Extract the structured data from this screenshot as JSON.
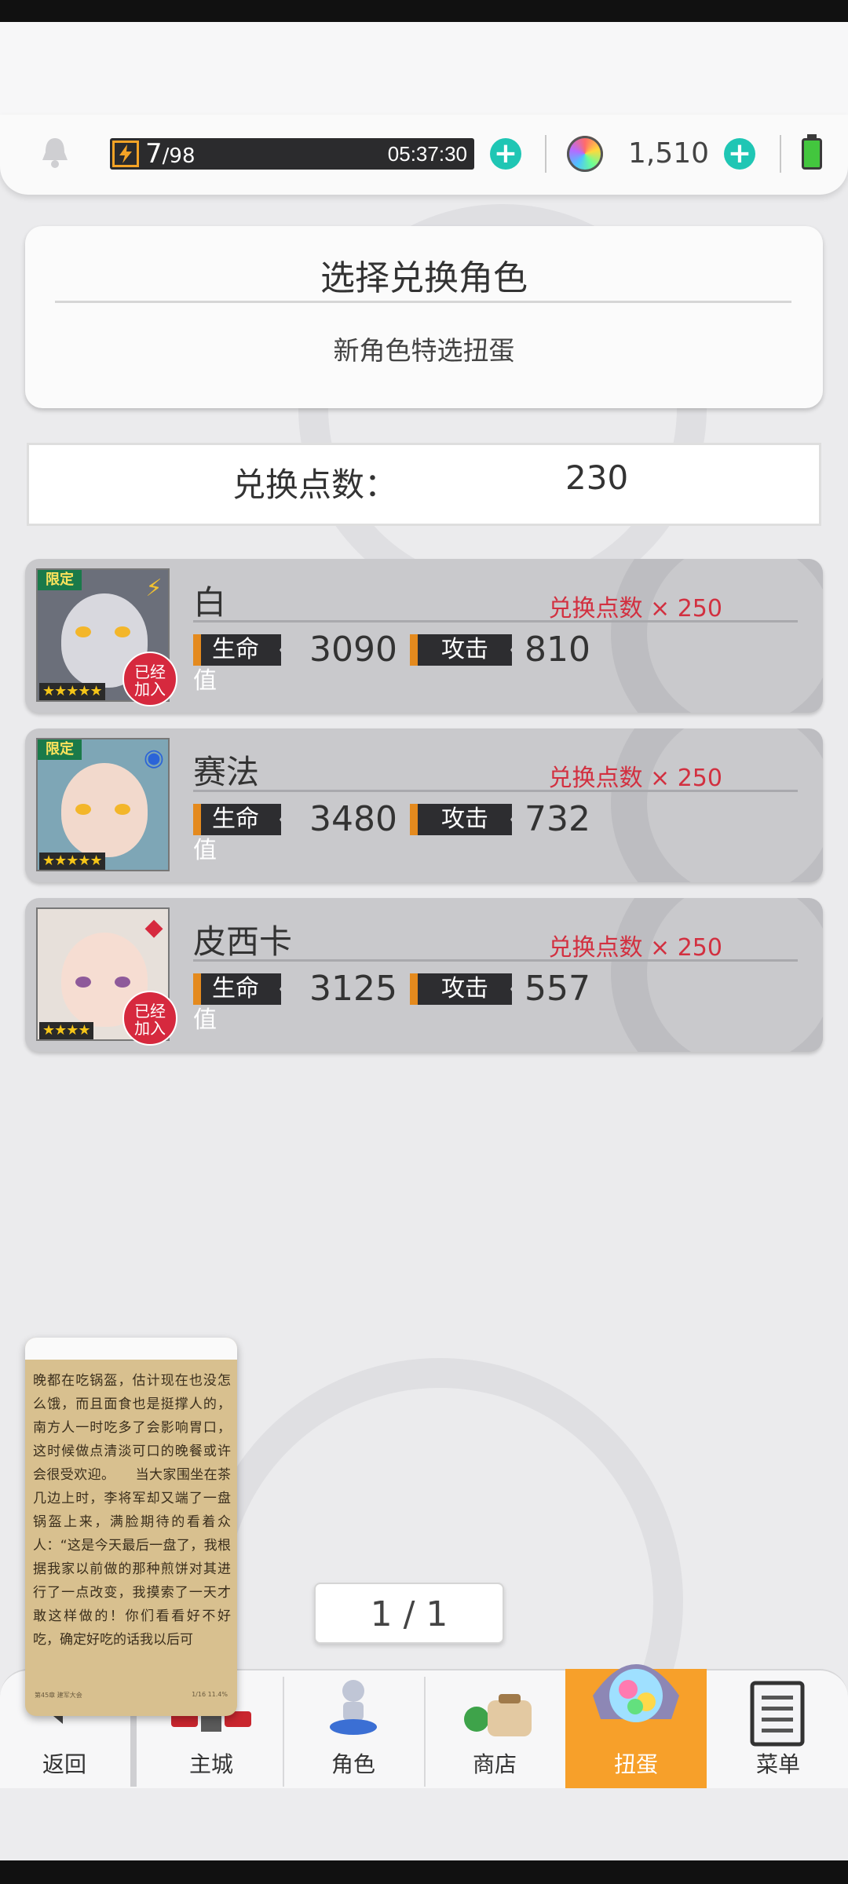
{
  "resource_bar": {
    "stamina_current": "7",
    "stamina_max": "/98",
    "stamina_timer": "05:37:30",
    "gems": "1,510",
    "icons": [
      "bell-icon",
      "lightning-icon",
      "plus-icon",
      "gem-icon",
      "battery-icon"
    ]
  },
  "header": {
    "title": "选择兑换角色",
    "subtitle": "新角色特选扭蛋"
  },
  "points": {
    "label": "兑换点数：",
    "value": "230"
  },
  "characters": [
    {
      "name": "白",
      "cost": "兑换点数 × 250",
      "hp_label": "生命值",
      "hp": "3090",
      "atk_label": "攻击",
      "atk": "810",
      "limited": "限定",
      "stars": "★★★★★",
      "joined": "已经加入",
      "element": "⚡"
    },
    {
      "name": "赛法",
      "cost": "兑换点数 × 250",
      "hp_label": "生命值",
      "hp": "3480",
      "atk_label": "攻击",
      "atk": "732",
      "limited": "限定",
      "stars": "★★★★★",
      "element": "◉"
    },
    {
      "name": "皮西卡",
      "cost": "兑换点数 × 250",
      "hp_label": "生命值",
      "hp": "3125",
      "atk_label": "攻击",
      "atk": "557",
      "stars": "★★★★",
      "joined": "已经加入",
      "element": "◆"
    }
  ],
  "joined_line1": "已经",
  "joined_line2": "加入",
  "reader": {
    "text": "晚都在吃锅盔，估计现在也没怎么饿，而且面食也是挺撑人的，南方人一时吃多了会影响胃口，这时候做点清淡可口的晚餐或许会很受欢迎。　　当大家围坐在茶几边上时，李将军却又端了一盘锅盔上来，满脸期待的看着众人：“这是今天最后一盘了，我根据我家以前做的那种煎饼对其进行了一点改变，我摸索了一天才敢这样做的！你们看看好不好吃，确定好吃的话我以后可",
    "footer_left": "第45章 建军大会",
    "footer_right": "1/16 11.4%"
  },
  "pager": "1 / 1",
  "nav": [
    {
      "label": "返回",
      "icon": "back-arrow-icon"
    },
    {
      "label": "主城",
      "icon": "castle-icon"
    },
    {
      "label": "角色",
      "icon": "character-icon"
    },
    {
      "label": "商店",
      "icon": "shop-bag-icon"
    },
    {
      "label": "扭蛋",
      "icon": "gacha-crystal-icon"
    },
    {
      "label": "菜单",
      "icon": "menu-document-icon"
    }
  ],
  "colors": {
    "accent_teal": "#1fc6b4",
    "cost_red": "#d23040",
    "stat_orange": "#e48a1e",
    "nav_active": "#f7a02a",
    "joined_red": "#d6293e"
  }
}
